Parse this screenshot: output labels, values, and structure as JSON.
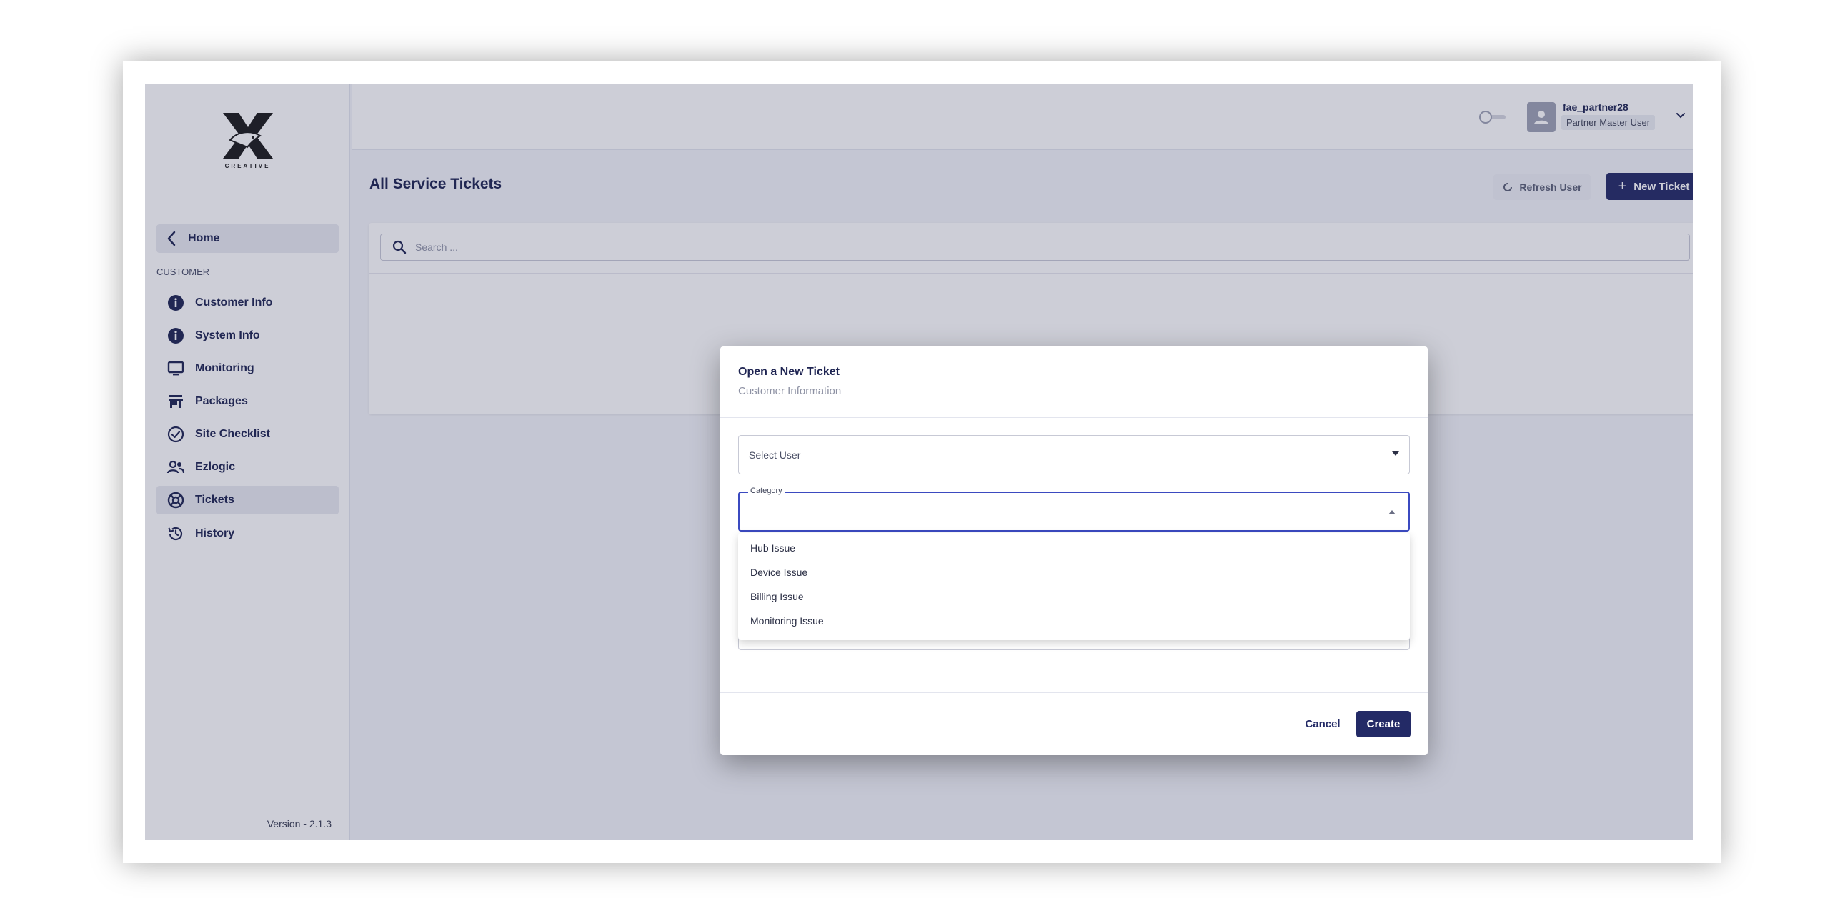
{
  "logo": {
    "text": "CREATIVE"
  },
  "sidebar": {
    "home_label": "Home",
    "section_title": "CUSTOMER",
    "items": [
      {
        "label": "Customer Info",
        "icon": "info-icon"
      },
      {
        "label": "System Info",
        "icon": "info-icon"
      },
      {
        "label": "Monitoring",
        "icon": "monitor-icon"
      },
      {
        "label": "Packages",
        "icon": "store-icon"
      },
      {
        "label": "Site Checklist",
        "icon": "check-circle-icon"
      },
      {
        "label": "Ezlogic",
        "icon": "people-icon"
      },
      {
        "label": "Tickets",
        "icon": "lifebuoy-icon",
        "active": true
      },
      {
        "label": "History",
        "icon": "history-icon"
      }
    ],
    "version": "Version - 2.1.3"
  },
  "header": {
    "user_name": "fae_partner28",
    "user_role": "Partner Master User"
  },
  "page": {
    "title": "All Service Tickets",
    "refresh_label": "Refresh User",
    "new_ticket_label": "New Ticket",
    "search_placeholder": "Search ..."
  },
  "modal": {
    "title": "Open a New Ticket",
    "subtitle": "Customer Information",
    "select_user_placeholder": "Select User",
    "category_label": "Category",
    "category_options": [
      "Hub Issue",
      "Device Issue",
      "Billing Issue",
      "Monitoring Issue"
    ],
    "cancel_label": "Cancel",
    "create_label": "Create"
  },
  "colors": {
    "primary": "#232a66",
    "focus": "#3b4ac0",
    "text": "#1e2452"
  }
}
